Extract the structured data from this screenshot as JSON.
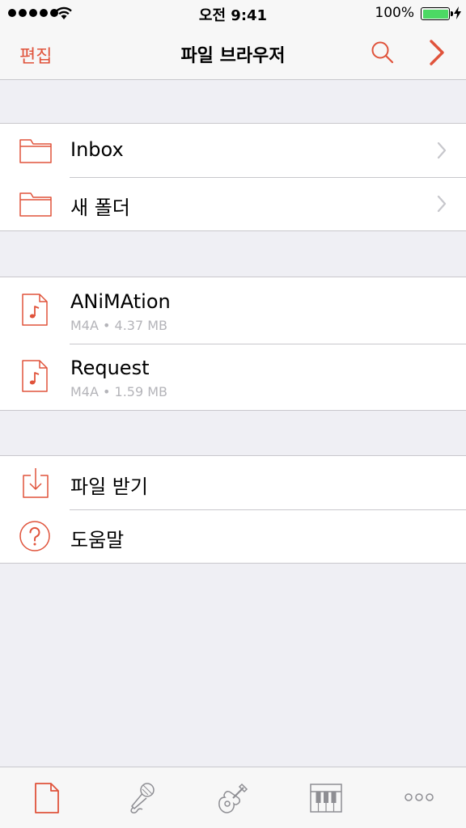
{
  "status_bar": {
    "time": "오전 9:41",
    "battery_percent": "100%",
    "signal_bars": 5,
    "icons": [
      "cellular-signal-icon",
      "wifi-icon",
      "battery-icon",
      "charging-bolt-icon"
    ]
  },
  "nav": {
    "edit_label": "편집",
    "title": "파일 브라우저",
    "icons": [
      "search-icon",
      "chevron-right-icon"
    ]
  },
  "folders": [
    {
      "label": "Inbox",
      "icon": "folder-icon"
    },
    {
      "label": "새 폴더",
      "icon": "folder-icon"
    }
  ],
  "files": [
    {
      "name": "ANiMAtion",
      "meta": "M4A • 4.37 MB",
      "icon": "music-file-icon"
    },
    {
      "name": "Request",
      "meta": "M4A • 1.59 MB",
      "icon": "music-file-icon"
    }
  ],
  "actions": [
    {
      "label": "파일 받기",
      "icon": "download-icon"
    },
    {
      "label": "도움말",
      "icon": "help-icon"
    }
  ],
  "tabs": [
    {
      "name": "files",
      "icon": "document-icon",
      "active": true
    },
    {
      "name": "microphone",
      "icon": "microphone-icon",
      "active": false
    },
    {
      "name": "guitar",
      "icon": "guitar-icon",
      "active": false
    },
    {
      "name": "piano",
      "icon": "piano-icon",
      "active": false
    },
    {
      "name": "more",
      "icon": "more-icon",
      "active": false
    }
  ],
  "colors": {
    "accent": "#e0533b",
    "background": "#efeff4",
    "separator": "#c8c7cc",
    "secondary_text": "#b4b4b9",
    "tab_inactive": "#8e8e93",
    "battery_green": "#4cd964"
  }
}
